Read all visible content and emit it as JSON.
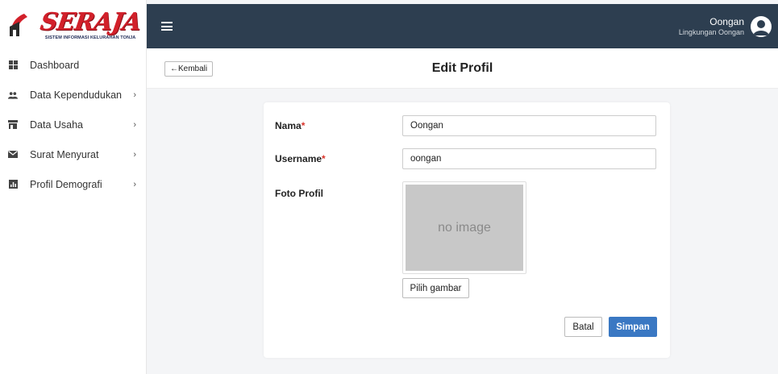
{
  "sidebar": {
    "logo_text": "SERAJA",
    "logo_subtitle": "SISTEM INFORMASI KELURAHAN TONJA",
    "items": [
      {
        "label": "Dashboard",
        "icon": "dashboard-icon",
        "has_submenu": false
      },
      {
        "label": "Data Kependudukan",
        "icon": "people-icon",
        "has_submenu": true
      },
      {
        "label": "Data Usaha",
        "icon": "store-icon",
        "has_submenu": true
      },
      {
        "label": "Surat Menyurat",
        "icon": "mail-icon",
        "has_submenu": true
      },
      {
        "label": "Profil Demografi",
        "icon": "chart-icon",
        "has_submenu": true
      }
    ],
    "chevron": "›"
  },
  "topbar": {
    "user_name": "Oongan",
    "user_role": "Lingkungan Oongan"
  },
  "header": {
    "back_label": "Kembali",
    "back_arrow": "←",
    "title": "Edit Profil"
  },
  "form": {
    "nama_label": "Nama",
    "username_label": "Username",
    "required_mark": "*",
    "nama_value": "Oongan",
    "username_value": "oongan",
    "photo_label": "Foto Profil",
    "photo_placeholder": "no image",
    "choose_image_label": "Pilih gambar",
    "cancel_label": "Batal",
    "save_label": "Simpan"
  },
  "colors": {
    "topbar": "#2d3e50",
    "primary": "#3a78c3",
    "brand_red": "#d2202a",
    "required": "#d9342b"
  }
}
